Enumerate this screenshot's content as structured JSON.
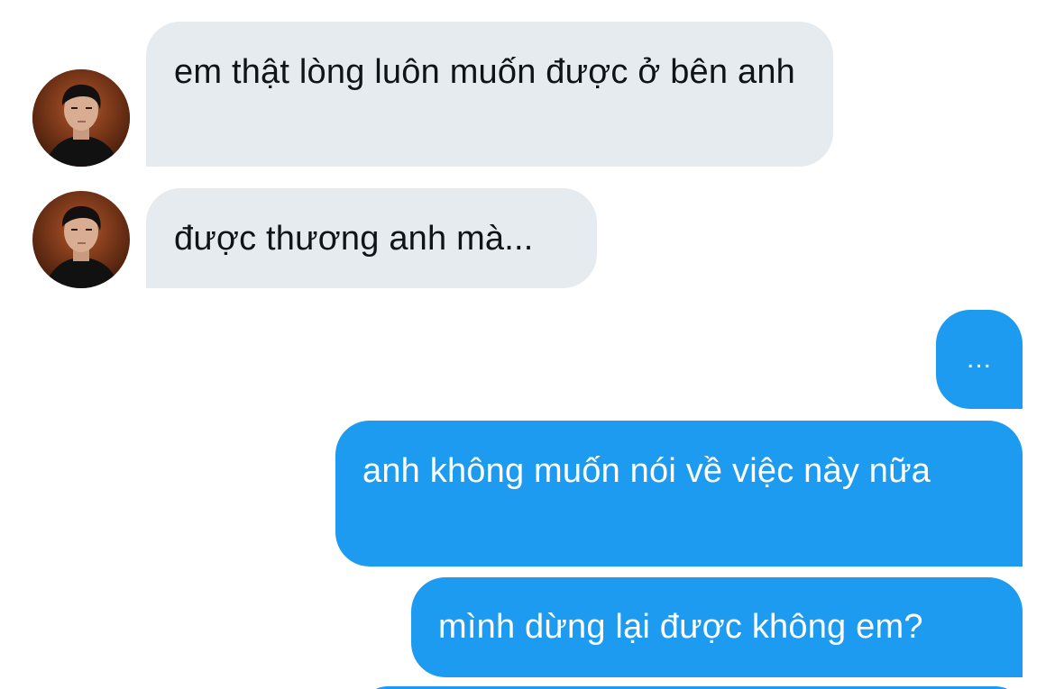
{
  "colors": {
    "incoming_bubble": "#e6ebef",
    "outgoing_bubble": "#1d9bf0",
    "incoming_text": "#0f1419",
    "outgoing_text": "#ffffff"
  },
  "messages": [
    {
      "direction": "incoming",
      "avatar": "contact-avatar",
      "text": "em thật lòng luôn muốn được ở bên anh"
    },
    {
      "direction": "incoming",
      "avatar": "contact-avatar",
      "text": "được thương anh mà..."
    },
    {
      "direction": "outgoing",
      "text": "..."
    },
    {
      "direction": "outgoing",
      "text": "anh không muốn nói về việc này nữa"
    },
    {
      "direction": "outgoing",
      "text": "mình dừng lại được không em?"
    },
    {
      "direction": "outgoing",
      "text": ""
    }
  ]
}
